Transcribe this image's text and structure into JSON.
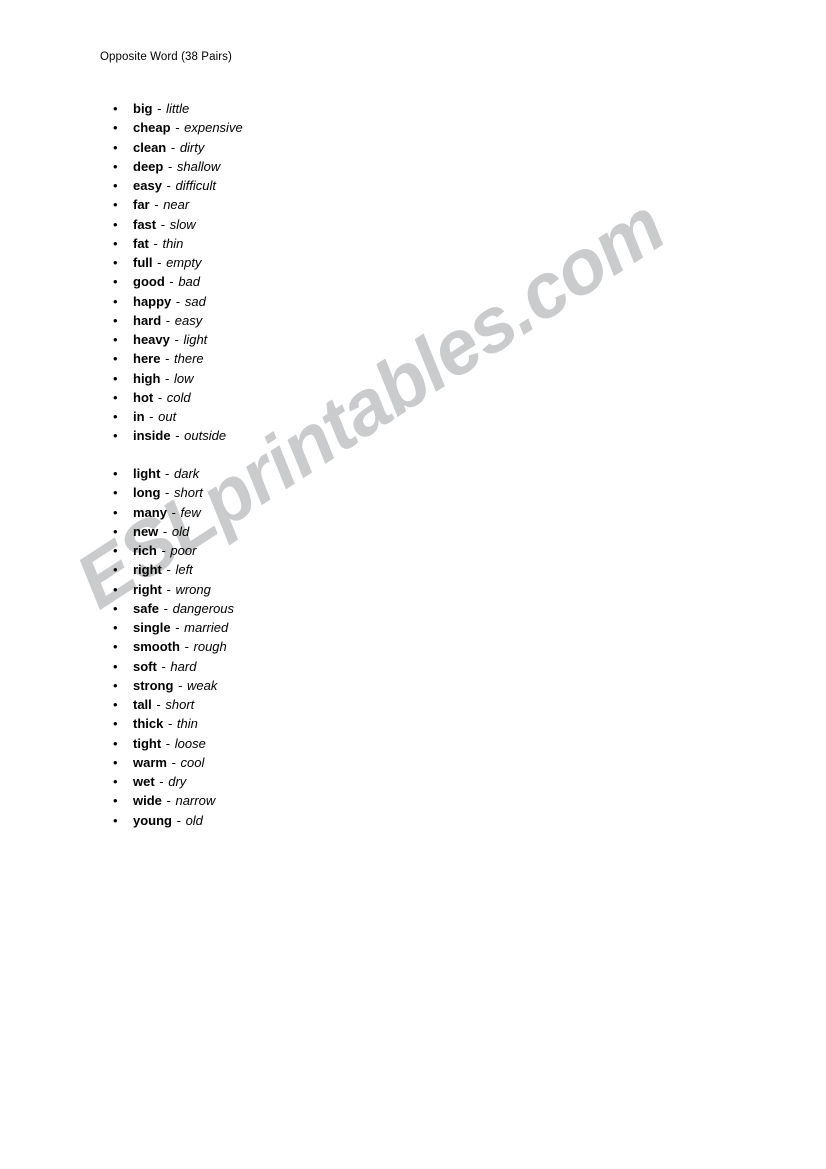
{
  "document": {
    "title": "Opposite Word (38 Pairs)",
    "separator": "-",
    "bullet_glyph": "•",
    "total_pairs": 38
  },
  "watermark": {
    "text": "ESLprintables.com",
    "color": "#c9cbcc",
    "angle_deg": -33
  },
  "groups": [
    {
      "id": "group-1",
      "items": [
        {
          "term": "big",
          "opposite": "little"
        },
        {
          "term": "cheap",
          "opposite": "expensive"
        },
        {
          "term": "clean",
          "opposite": "dirty"
        },
        {
          "term": "deep",
          "opposite": "shallow"
        },
        {
          "term": "easy",
          "opposite": "difficult"
        },
        {
          "term": "far",
          "opposite": "near"
        },
        {
          "term": "fast",
          "opposite": "slow"
        },
        {
          "term": "fat",
          "opposite": "thin"
        },
        {
          "term": "full",
          "opposite": "empty"
        },
        {
          "term": "good",
          "opposite": "bad"
        },
        {
          "term": "happy",
          "opposite": "sad"
        },
        {
          "term": "hard",
          "opposite": "easy"
        },
        {
          "term": "heavy",
          "opposite": "light"
        },
        {
          "term": "here",
          "opposite": "there"
        },
        {
          "term": "high",
          "opposite": "low"
        },
        {
          "term": "hot",
          "opposite": "cold"
        },
        {
          "term": "in",
          "opposite": "out"
        },
        {
          "term": "inside",
          "opposite": "outside"
        }
      ]
    },
    {
      "id": "group-2",
      "items": [
        {
          "term": "light",
          "opposite": "dark"
        },
        {
          "term": "long",
          "opposite": "short"
        },
        {
          "term": "many",
          "opposite": "few"
        },
        {
          "term": "new",
          "opposite": "old"
        },
        {
          "term": "rich",
          "opposite": "poor"
        },
        {
          "term": "right",
          "opposite": "left"
        },
        {
          "term": "right",
          "opposite": "wrong"
        },
        {
          "term": "safe",
          "opposite": "dangerous"
        },
        {
          "term": "single",
          "opposite": "married"
        },
        {
          "term": "smooth",
          "opposite": "rough"
        },
        {
          "term": "soft",
          "opposite": "hard"
        },
        {
          "term": "strong",
          "opposite": "weak"
        },
        {
          "term": "tall",
          "opposite": "short"
        },
        {
          "term": "thick",
          "opposite": "thin"
        },
        {
          "term": "tight",
          "opposite": "loose"
        },
        {
          "term": "warm",
          "opposite": "cool"
        },
        {
          "term": "wet",
          "opposite": "dry"
        },
        {
          "term": "wide",
          "opposite": "narrow"
        },
        {
          "term": "young",
          "opposite": "old"
        }
      ]
    }
  ]
}
